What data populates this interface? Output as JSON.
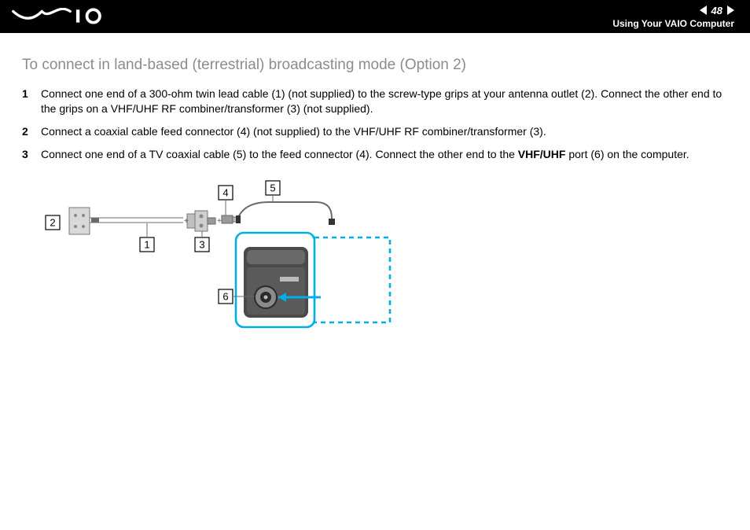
{
  "header": {
    "page_number": "48",
    "section": "Using Your VAIO Computer"
  },
  "title": "To connect in land-based (terrestrial) broadcasting mode (Option 2)",
  "steps": [
    {
      "num": "1",
      "text": "Connect one end of a 300-ohm twin lead cable (1) (not supplied) to the screw-type grips at your antenna outlet (2). Connect the other end to the grips on a VHF/UHF RF combiner/transformer (3) (not supplied)."
    },
    {
      "num": "2",
      "text": "Connect a coaxial cable feed connector (4) (not supplied) to the VHF/UHF RF combiner/transformer (3)."
    },
    {
      "num": "3",
      "text_parts": [
        "Connect one end of a TV coaxial cable (5) to the feed connector (4). Connect the other end to the ",
        "VHF/UHF",
        " port (6) on the computer."
      ]
    }
  ],
  "diagram": {
    "callouts": {
      "c1": "1",
      "c2": "2",
      "c3": "3",
      "c4": "4",
      "c5": "5",
      "c6": "6"
    }
  }
}
